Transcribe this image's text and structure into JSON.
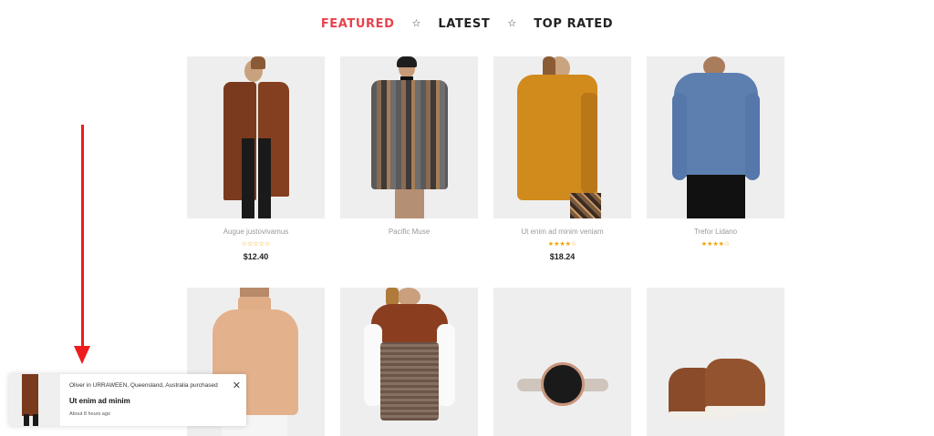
{
  "tabs": [
    {
      "label": "FEATURED",
      "active": true
    },
    {
      "label": "LATEST",
      "active": false
    },
    {
      "label": "TOP RATED",
      "active": false
    }
  ],
  "tab_separator_icon": "star-outline-icon",
  "products": [
    {
      "name": "Augue justovivamus",
      "stars": "☆☆☆☆☆",
      "price": "$12.40",
      "image": "brown-coat"
    },
    {
      "name": "Pacific Muse",
      "stars": "",
      "price": "",
      "image": "striped-poncho"
    },
    {
      "name": "Ut enim ad minim veniam",
      "stars": "★★★★☆",
      "price": "$18.24",
      "image": "mustard-coat"
    },
    {
      "name": "Trefor Lidano",
      "stars": "★★★★☆",
      "price": "",
      "image": "blue-sweater"
    },
    {
      "name": "",
      "stars": "",
      "price": "",
      "image": "beige-turtleneck"
    },
    {
      "name": "",
      "stars": "",
      "price": "",
      "image": "scarf-vest"
    },
    {
      "name": "",
      "stars": "",
      "price": "",
      "image": "wristwatch"
    },
    {
      "name": "",
      "stars": "",
      "price": "",
      "image": "brown-sneakers"
    }
  ],
  "notification": {
    "line1": "Oliver in URRAWEEN, Queensland, Australia purchased",
    "title": "Ut enim ad minim",
    "time": "About 8 hours ago",
    "close_icon": "close-icon"
  },
  "colors": {
    "accent": "#e8424d",
    "star": "#f0a500",
    "arrow": "#ee1c1c"
  }
}
